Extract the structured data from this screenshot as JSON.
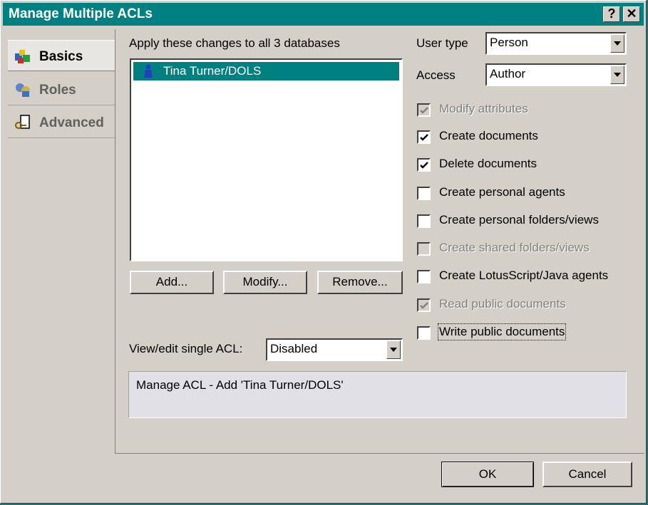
{
  "window": {
    "title": "Manage Multiple ACLs",
    "help_glyph": "?",
    "close_glyph": "✕"
  },
  "nav": {
    "items": [
      {
        "label": "Basics",
        "icon": "basics-icon",
        "active": true
      },
      {
        "label": "Roles",
        "icon": "roles-icon",
        "active": false
      },
      {
        "label": "Advanced",
        "icon": "advanced-icon",
        "active": false
      }
    ]
  },
  "main": {
    "apply_label": "Apply these changes to all 3 databases",
    "list": [
      {
        "name": "Tina Turner/DOLS",
        "icon": "person-icon",
        "selected": true
      }
    ],
    "buttons": {
      "add": "Add...",
      "modify": "Modify...",
      "remove": "Remove..."
    },
    "view_edit_label": "View/edit single ACL:",
    "view_edit_value": "Disabled",
    "status_text": "Manage ACL - Add 'Tina Turner/DOLS'"
  },
  "right": {
    "user_type_label": "User type",
    "user_type_value": "Person",
    "access_label": "Access",
    "access_value": "Author",
    "checkboxes": [
      {
        "label": "Modify attributes",
        "checked": true,
        "disabled": true
      },
      {
        "label": "Create documents",
        "checked": true,
        "disabled": false
      },
      {
        "label": "Delete documents",
        "checked": true,
        "disabled": false
      },
      {
        "label": "Create personal agents",
        "checked": false,
        "disabled": false
      },
      {
        "label": "Create personal folders/views",
        "checked": false,
        "disabled": false
      },
      {
        "label": "Create shared folders/views",
        "checked": false,
        "disabled": true
      },
      {
        "label": "Create LotusScript/Java agents",
        "checked": false,
        "disabled": false
      },
      {
        "label": "Read public documents",
        "checked": true,
        "disabled": true
      },
      {
        "label": "Write public documents",
        "checked": false,
        "disabled": false
      }
    ]
  },
  "footer": {
    "ok": "OK",
    "cancel": "Cancel"
  },
  "colors": {
    "title_bg": "#008080",
    "face": "#d4d0c8",
    "selection": "#008080",
    "disabled_text": "#808080"
  }
}
